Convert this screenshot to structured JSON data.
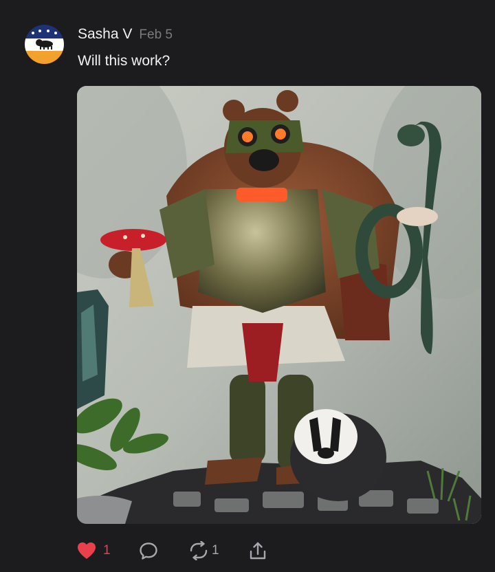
{
  "post": {
    "author": "Sasha V",
    "date": "Feb 5",
    "text": "Will this work?",
    "avatar_icon": "bison-flag-avatar",
    "image_icon": "bear-warrior-figure-image",
    "actions": {
      "like_count": "1",
      "repost_count": "1"
    }
  },
  "colors": {
    "background": "#1c1c1f",
    "text": "#f2f2f5",
    "muted": "#7b7b82",
    "like_red": "#e8414d",
    "icon_gray": "#a7a7ae"
  }
}
